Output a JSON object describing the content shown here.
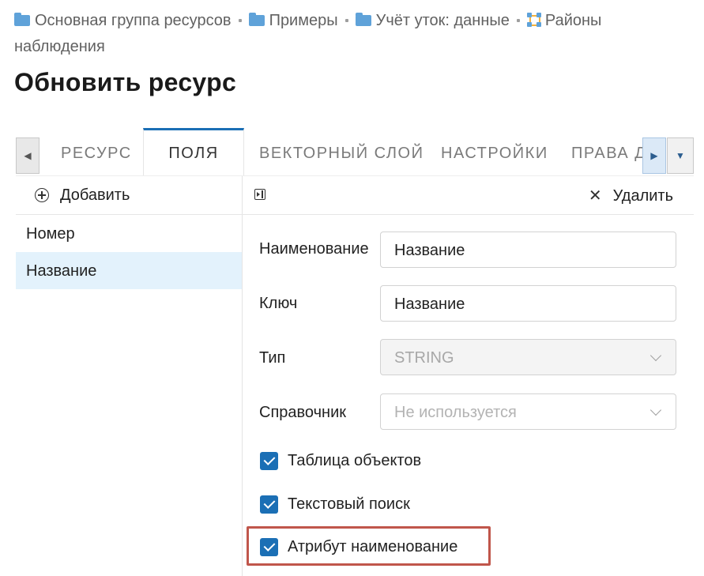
{
  "breadcrumb": {
    "items": [
      {
        "label": "Основная группа ресурсов",
        "icon": "folder-icon"
      },
      {
        "label": "Примеры",
        "icon": "folder-icon"
      },
      {
        "label": "Учёт уток: данные",
        "icon": "folder-icon"
      },
      {
        "label": "Районы наблюдения",
        "icon": "vector-polygon-icon"
      }
    ]
  },
  "page_title": "Обновить ресурс",
  "tabs": {
    "items": [
      "РЕСУРС",
      "ПОЛЯ",
      "ВЕКТОРНЫЙ СЛОЙ",
      "НАСТРОЙКИ",
      "ПРАВА Д"
    ],
    "selected": "ПОЛЯ"
  },
  "fields_panel": {
    "add_label": "Добавить",
    "items": [
      "Номер",
      "Название"
    ],
    "selected": "Название"
  },
  "toolbar": {
    "delete_label": "Удалить"
  },
  "form": {
    "name_label": "Наименование",
    "name_value": "Название",
    "key_label": "Ключ",
    "key_value": "Название",
    "type_label": "Тип",
    "type_value": "STRING",
    "lookup_label": "Справочник",
    "lookup_placeholder": "Не используется",
    "checkboxes": [
      {
        "label": "Таблица объектов",
        "checked": true
      },
      {
        "label": "Текстовый поиск",
        "checked": true
      },
      {
        "label": "Атрибут наименование",
        "checked": true
      }
    ]
  },
  "colors": {
    "accent": "#1b6fb5",
    "selected_row": "#e3f2fc",
    "highlight": "#c0564b",
    "folder": "#5fa2d9"
  }
}
